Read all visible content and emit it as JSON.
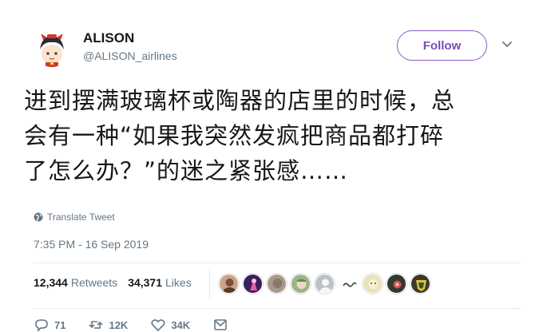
{
  "user": {
    "name": "ALISON",
    "handle": "@ALISON_airlines",
    "follow_label": "Follow"
  },
  "tweet": {
    "text": "进到摆满玻璃杯或陶器的店里的时候，总\n会有一种“如果我突然发疯把商品都打碎\n了怎么办？”的迷之紧张感……",
    "translate_label": "Translate Tweet",
    "timestamp": "7:35 PM - 16 Sep 2019"
  },
  "stats": {
    "retweets_count": "12,344",
    "retweets_label": "Retweets",
    "likes_count": "34,371",
    "likes_label": "Likes"
  },
  "liker_avatars": [
    {
      "color": "#c9a38a",
      "icon": "avatar-portrait"
    },
    {
      "color": "#3b1f5c",
      "icon": "avatar-figure-pink"
    },
    {
      "color": "#a89a8a",
      "icon": "avatar-grey"
    },
    {
      "color": "#9cb48a",
      "icon": "avatar-character"
    },
    {
      "color": "#b9c2c9",
      "icon": "avatar-default"
    },
    {
      "color": "#ffffff",
      "icon": "avatar-squiggle"
    },
    {
      "color": "#e8e2b6",
      "icon": "avatar-light"
    },
    {
      "color": "#2f3b2c",
      "icon": "avatar-dark-flower"
    },
    {
      "color": "#3a3a2a",
      "icon": "avatar-badge-yellow"
    }
  ],
  "actions": {
    "replies": "71",
    "retweets": "12K",
    "likes": "34K"
  },
  "colors": {
    "follow_accent": "#7a4bb8",
    "muted": "#657786",
    "text": "#14171a"
  }
}
